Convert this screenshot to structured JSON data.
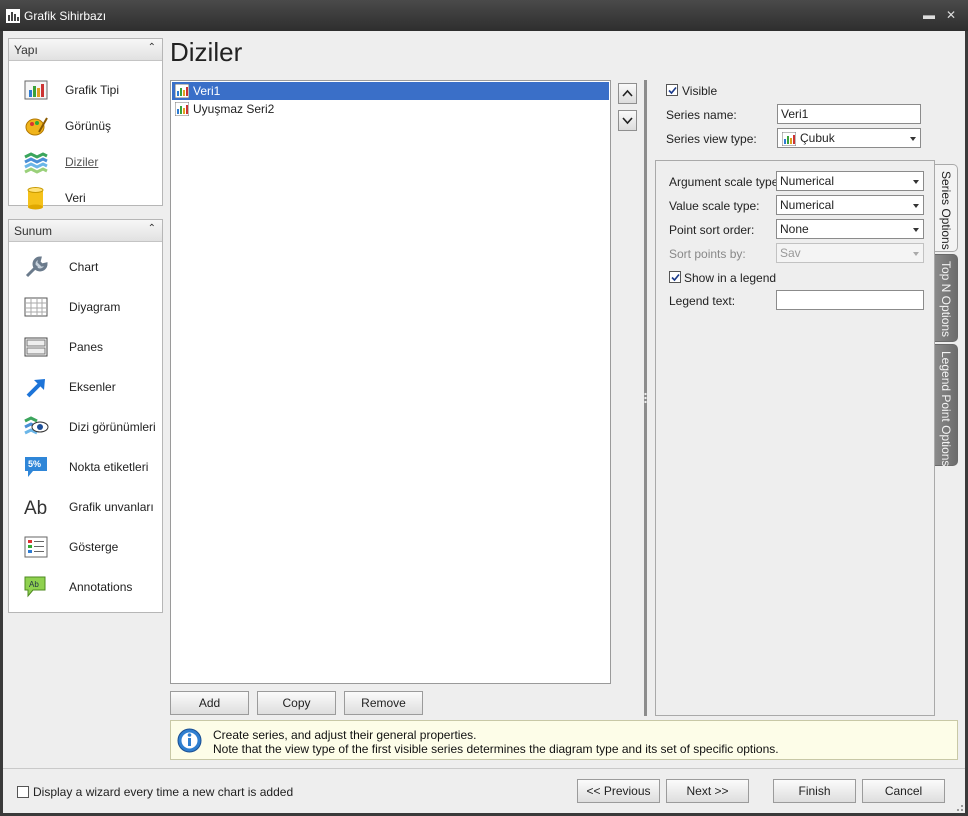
{
  "window": {
    "title": "Grafik Sihirbazı"
  },
  "nav": {
    "group1": {
      "title": "Yapı",
      "items": [
        {
          "label": "Grafik Tipi",
          "icon": "chart-type-icon"
        },
        {
          "label": "Görünüş",
          "icon": "appearance-palette-icon"
        },
        {
          "label": "Diziler",
          "icon": "series-icon",
          "active": true
        },
        {
          "label": "Veri",
          "icon": "data-cylinder-icon"
        }
      ]
    },
    "group2": {
      "title": "Sunum",
      "items": [
        {
          "label": "Chart",
          "icon": "wrench-icon"
        },
        {
          "label": "Diyagram",
          "icon": "diagram-grid-icon"
        },
        {
          "label": "Panes",
          "icon": "panes-icon"
        },
        {
          "label": "Eksenler",
          "icon": "axes-arrow-icon"
        },
        {
          "label": "Dizi görünümleri",
          "icon": "series-views-icon"
        },
        {
          "label": "Nokta etiketleri",
          "icon": "point-labels-icon"
        },
        {
          "label": "Grafik unvanları",
          "icon": "chart-titles-icon"
        },
        {
          "label": "Gösterge",
          "icon": "legend-icon"
        },
        {
          "label": "Annotations",
          "icon": "annotations-icon"
        }
      ]
    }
  },
  "page": {
    "heading": "Diziler"
  },
  "series_list": {
    "items": [
      {
        "label": "Veri1",
        "selected": true
      },
      {
        "label": "Uyuşmaz Seri2",
        "selected": false
      }
    ]
  },
  "list_buttons": {
    "add": "Add",
    "copy": "Copy",
    "remove": "Remove"
  },
  "properties": {
    "visible_label": "Visible",
    "visible_checked": true,
    "series_name_label": "Series name:",
    "series_name_value": "Veri1",
    "view_type_label": "Series view type:",
    "view_type_value": "Çubuk"
  },
  "series_options": {
    "argument_scale_label": "Argument scale type:",
    "argument_scale_value": "Numerical",
    "value_scale_label": "Value scale type:",
    "value_scale_value": "Numerical",
    "point_sort_label": "Point sort order:",
    "point_sort_value": "None",
    "sort_by_label": "Sort points by:",
    "sort_by_value": "Sav",
    "show_legend_label": "Show in a legend",
    "show_legend_checked": true,
    "legend_text_label": "Legend text:",
    "legend_text_value": ""
  },
  "tabs": {
    "series_options": "Series Options",
    "top_n": "Top N Options",
    "legend_point": "Legend Point Options"
  },
  "info": {
    "line1": "Create series, and adjust their general properties.",
    "line2": "Note that the view type of the first visible series determines the diagram type and its set of specific options."
  },
  "footer": {
    "show_wizard_label": "Display a wizard every time a new chart is added",
    "show_wizard_checked": false,
    "previous": "<< Previous",
    "next": "Next >>",
    "finish": "Finish",
    "cancel": "Cancel"
  },
  "colors": {
    "selection": "#3a6fc8",
    "titlebar": "#333333",
    "info_background": "#fdfde8"
  }
}
